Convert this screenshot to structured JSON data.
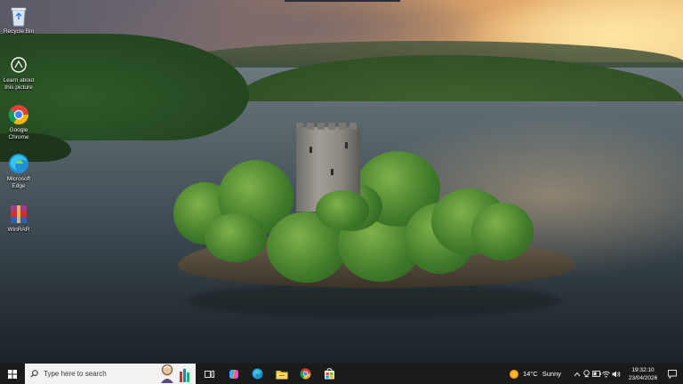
{
  "desktop_icons": [
    {
      "name": "recycle-bin",
      "label": "Recycle Bin",
      "icon": "recycle-bin-icon"
    },
    {
      "name": "learn-about-picture",
      "label_line1": "Learn about",
      "label_line2": "this picture",
      "icon": "camera-info-icon"
    },
    {
      "name": "google-chrome",
      "label_line1": "Google",
      "label_line2": "Chrome",
      "icon": "chrome-icon"
    },
    {
      "name": "microsoft-edge",
      "label_line1": "Microsoft",
      "label_line2": "Edge",
      "icon": "edge-icon"
    },
    {
      "name": "winrar",
      "label": "WinRAR",
      "icon": "winrar-icon"
    }
  ],
  "taskbar": {
    "search_placeholder": "Type here to search",
    "pinned_apps": [
      "task-view",
      "copilot",
      "edge",
      "file-explorer",
      "chrome",
      "microsoft-store"
    ],
    "weather": {
      "temp": "14°C",
      "condition": "Sunny"
    },
    "clock": {
      "time": "19:32:10",
      "date": "23/04/2026"
    }
  },
  "colors": {
    "taskbar_bg": "#1b1b1c",
    "search_bg": "#f2f2f2",
    "label_text": "#ffffff"
  }
}
